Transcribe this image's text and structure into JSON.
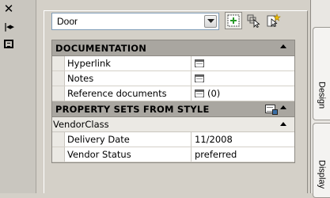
{
  "left_toolbar": {
    "close_icon": "close-icon",
    "autohide_icon": "auto-hide-icon",
    "properties_icon": "properties-icon"
  },
  "style_selector": {
    "value": "Door"
  },
  "toolbar_buttons": [
    {
      "icon": "add-property-icon"
    },
    {
      "icon": "select-objects-icon"
    },
    {
      "icon": "quick-select-icon"
    }
  ],
  "sections": {
    "documentation": {
      "title": "DOCUMENTATION",
      "rows": [
        {
          "label": "Hyperlink",
          "value": ""
        },
        {
          "label": "Notes",
          "value": ""
        },
        {
          "label": "Reference documents",
          "value": "(0)"
        }
      ]
    },
    "property_sets": {
      "title": "PROPERTY SETS FROM STYLE",
      "group": "VendorClass",
      "rows": [
        {
          "label": "Delivery Date",
          "value": "11/2008"
        },
        {
          "label": "Vendor Status",
          "value": "preferred"
        }
      ]
    }
  },
  "side_tabs": {
    "design": "Design",
    "display": "Display"
  }
}
